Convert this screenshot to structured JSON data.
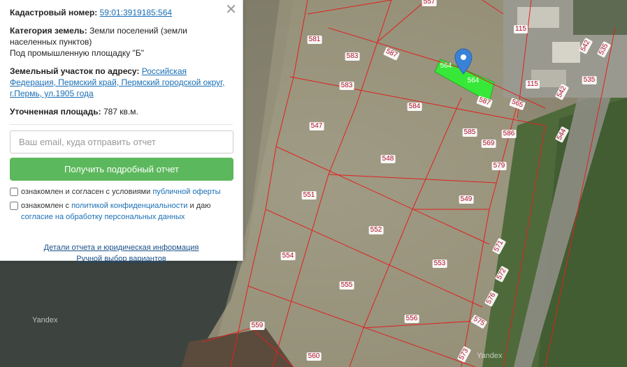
{
  "panel": {
    "cadastral_label": "Кадастровый номер:",
    "cadastral_number": "59:01:3919185:564",
    "category_label": "Категория земель:",
    "category_value": "Земли поселений (земли населенных пунктов)",
    "category_extra": "Под промышленную площадку \"Б\"",
    "address_label": "Земельный участок по адресу:",
    "address_value": "Российская Федерация, Пермский край, Пермский городской округ, г.Пермь, ул.1905 года",
    "area_label": "Уточненная площадь:",
    "area_value": "787 кв.м.",
    "email_placeholder": "Ваш email, куда отправить отчет",
    "submit_label": "Получить подробный отчет",
    "consent1_text": "ознакомлен и согласен с условиями",
    "consent1_link": "публичной оферты",
    "consent2_text_a": "ознакомлен с",
    "consent2_link1": "политикой конфиденциальности",
    "consent2_text_b": "и даю",
    "consent2_link2": "согласие на обработку персональных данных",
    "details_link": "Детали отчета и юридическая информация",
    "manual_link": "Ручной выбор вариантов",
    "close_glyph": "✕"
  },
  "map": {
    "watermark": "Yandex",
    "selected_color": "#38e838",
    "boundary_color": "#e02020",
    "plots": [
      "557",
      "581",
      "583",
      "587",
      "564",
      "564",
      "115",
      "115",
      "542",
      "535",
      "535",
      "583",
      "584",
      "587",
      "565",
      "542",
      "547",
      "585",
      "586",
      "569",
      "544",
      "548",
      "579",
      "551",
      "549",
      "552",
      "571",
      "554",
      "553",
      "572",
      "555",
      "576",
      "556",
      "575",
      "559",
      "560",
      "573"
    ]
  },
  "icons": {
    "close": "close-icon",
    "pin": "map-pin-icon"
  }
}
